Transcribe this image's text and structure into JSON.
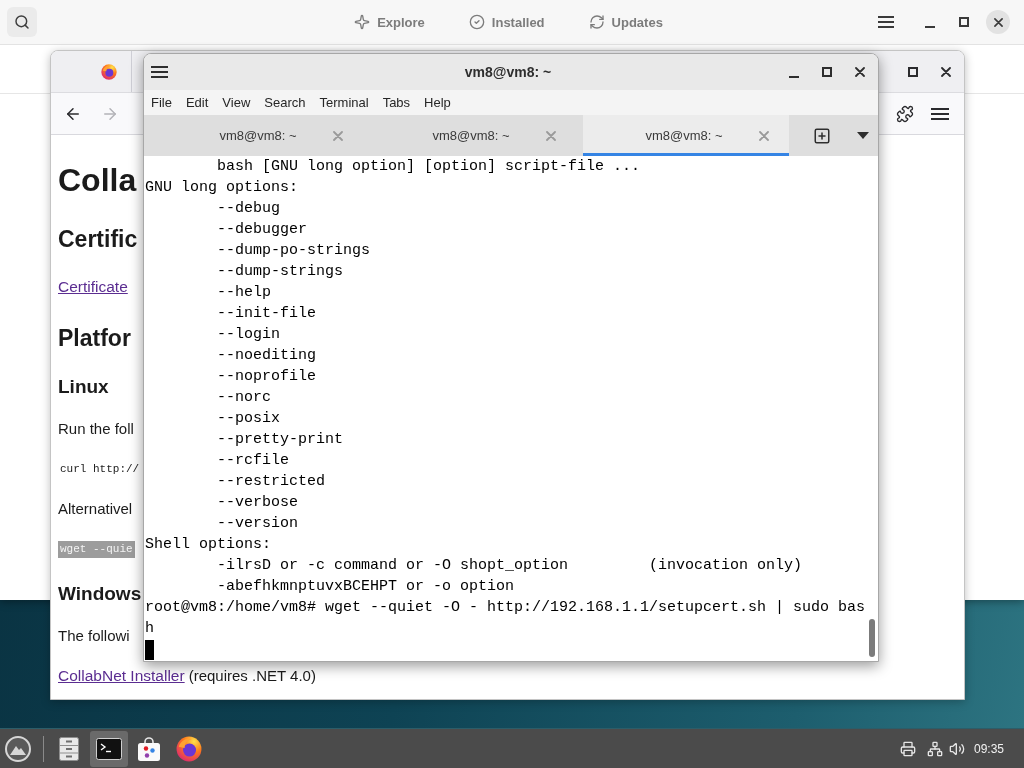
{
  "software_center": {
    "tabs": [
      {
        "label": "Explore",
        "selected": false
      },
      {
        "label": "Installed",
        "selected": false
      },
      {
        "label": "Updates",
        "selected": false
      }
    ]
  },
  "browser": {
    "nav_buttons": [
      {
        "kind": "back",
        "disabled": false
      },
      {
        "kind": "forward",
        "disabled": true
      }
    ],
    "content": [
      {
        "kind": "h1",
        "text": "Colla"
      },
      {
        "kind": "h2",
        "text": "Certific"
      },
      {
        "kind": "link",
        "text": "Certificate"
      },
      {
        "kind": "h2",
        "text": "Platfor"
      },
      {
        "kind": "h3",
        "text": "Linux"
      },
      {
        "kind": "paragraph",
        "text": "Run the foll"
      },
      {
        "kind": "code",
        "text": "curl http://",
        "highlighted": false
      },
      {
        "kind": "paragraph",
        "text": "Alternativel"
      },
      {
        "kind": "code",
        "text": "wget --quie",
        "highlighted": true
      },
      {
        "kind": "h3",
        "text": "Windows"
      },
      {
        "kind": "paragraph",
        "text": "The followi"
      },
      {
        "kind": "link_line",
        "link": "CollabNet Installer",
        "text": "(requires .NET 4.0)"
      }
    ]
  },
  "terminal": {
    "title": "vm8@vm8: ~",
    "menu": [
      "File",
      "Edit",
      "View",
      "Search",
      "Terminal",
      "Tabs",
      "Help"
    ],
    "tabs": [
      {
        "label": "vm8@vm8: ~",
        "selected": false
      },
      {
        "label": "vm8@vm8: ~",
        "selected": false
      },
      {
        "label": "vm8@vm8: ~",
        "selected": true
      }
    ],
    "lines": [
      "        bash [GNU long option] [option] script-file ...",
      "GNU long options:",
      "        --debug",
      "        --debugger",
      "        --dump-po-strings",
      "        --dump-strings",
      "        --help",
      "        --init-file",
      "        --login",
      "        --noediting",
      "        --noprofile",
      "        --norc",
      "        --posix",
      "        --pretty-print",
      "        --rcfile",
      "        --restricted",
      "        --verbose",
      "        --version",
      "Shell options:",
      "        -ilrsD or -c command or -O shopt_option         (invocation only)",
      "        -abefhkmnptuvxBCEHPT or -o option",
      "root@vm8:/home/vm8# wget --quiet -O - http://192.168.1.1/setupcert.sh | sudo bas",
      "h"
    ],
    "cursor": true
  },
  "taskbar": {
    "apps": [
      {
        "kind": "files",
        "selected": false
      },
      {
        "kind": "terminal",
        "selected": true
      },
      {
        "kind": "store",
        "selected": false
      },
      {
        "kind": "browser",
        "selected": false
      }
    ],
    "clock": "09:35"
  }
}
